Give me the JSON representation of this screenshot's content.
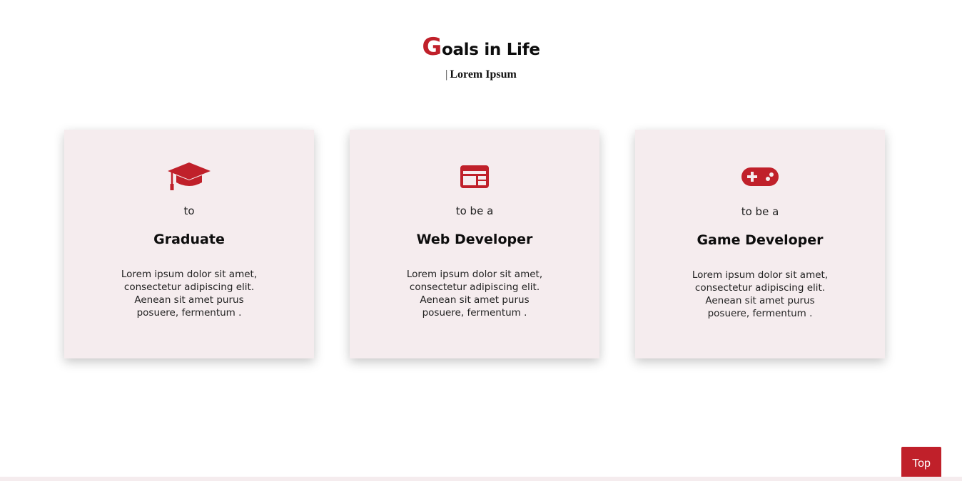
{
  "header": {
    "title_first_letter": "G",
    "title_rest": "oals in Life",
    "subtitle_bar": "|",
    "subtitle": "Lorem Ipsum"
  },
  "cards": [
    {
      "icon": "graduation-cap-icon",
      "prefix": "to",
      "role": "Graduate",
      "description": "Lorem ipsum dolor sit amet, consectetur adipiscing elit. Aenean sit amet purus posuere, fermentum ."
    },
    {
      "icon": "browser-window-icon",
      "prefix": "to be a",
      "role": "Web Developer",
      "description": "Lorem ipsum dolor sit amet, consectetur adipiscing elit. Aenean sit amet purus posuere, fermentum ."
    },
    {
      "icon": "gamepad-icon",
      "prefix": "to be a",
      "role": "Game Developer",
      "description": "Lorem ipsum dolor sit amet, consectetur adipiscing elit. Aenean sit amet purus posuere, fermentum ."
    }
  ],
  "top_button": {
    "label": "Top"
  },
  "colors": {
    "accent": "#c0202a",
    "card_background": "#f5ecee",
    "text": "#0d0d0d"
  }
}
